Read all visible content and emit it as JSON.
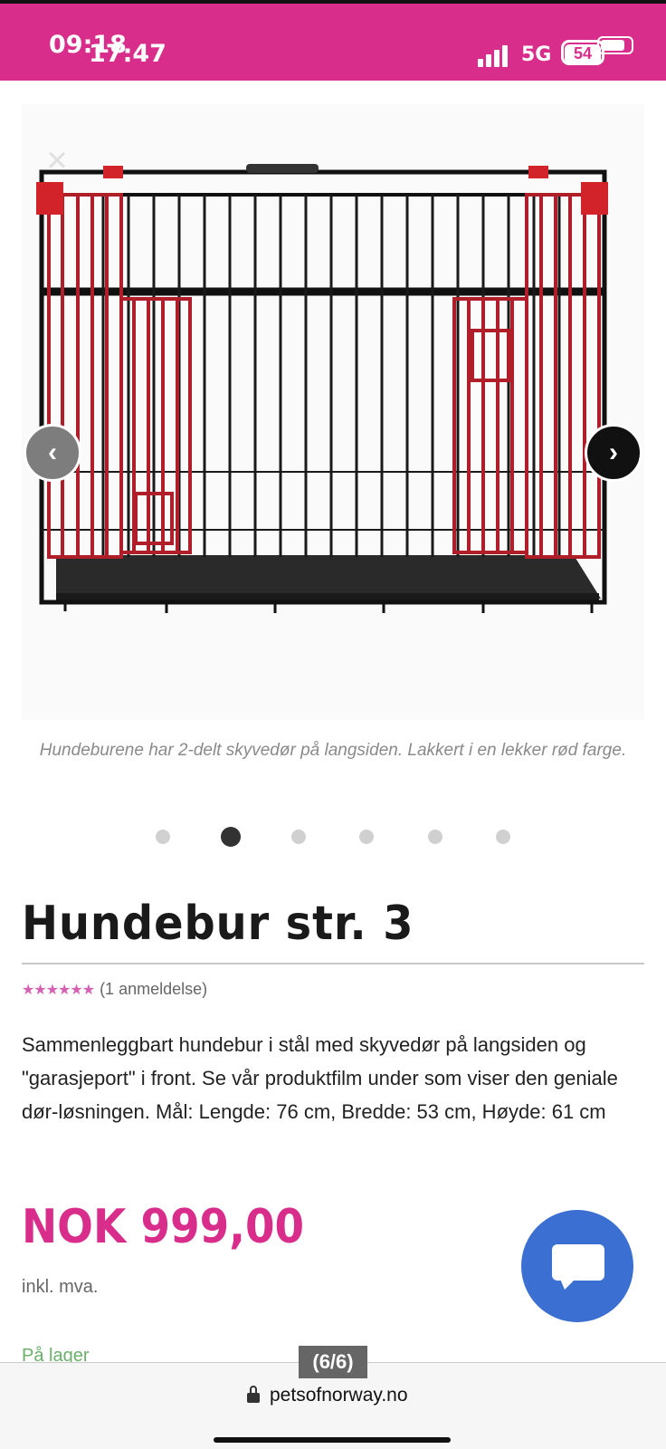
{
  "status_bar": {
    "time_overlay": "09:18",
    "time": "17:47",
    "network": "5G",
    "battery": "54"
  },
  "gallery": {
    "caption": "Hundeburene har 2-delt skyvedør på langsiden. Lakkert i en lekker rød farge.",
    "prev_icon": "chevron-left-icon",
    "next_icon": "chevron-right-icon",
    "close_icon": "close-icon",
    "active_index": 1,
    "dot_count": 6
  },
  "product": {
    "title": "Hundebur str. 3",
    "stars": "★★★★★★",
    "review_count": "(1 anmeldelse)",
    "description": "Sammenleggbart hundebur i stål med skyvedør på langsiden og \"garasjeport\" i front. Se vår produktfilm under som viser den geniale dør-løsningen. Mål: Lengde: 76 cm, Bredde: 53 cm, Høyde: 61 cm",
    "price": "NOK 999,00",
    "vat": "inkl. mva.",
    "stock": "På lager"
  },
  "overlay": {
    "image_counter": "(6/6)"
  },
  "browser": {
    "domain": "petsofnorway.no"
  },
  "colors": {
    "brand": "#d92d8b",
    "chat": "#3b6fd1",
    "stock": "#6ab06a"
  }
}
